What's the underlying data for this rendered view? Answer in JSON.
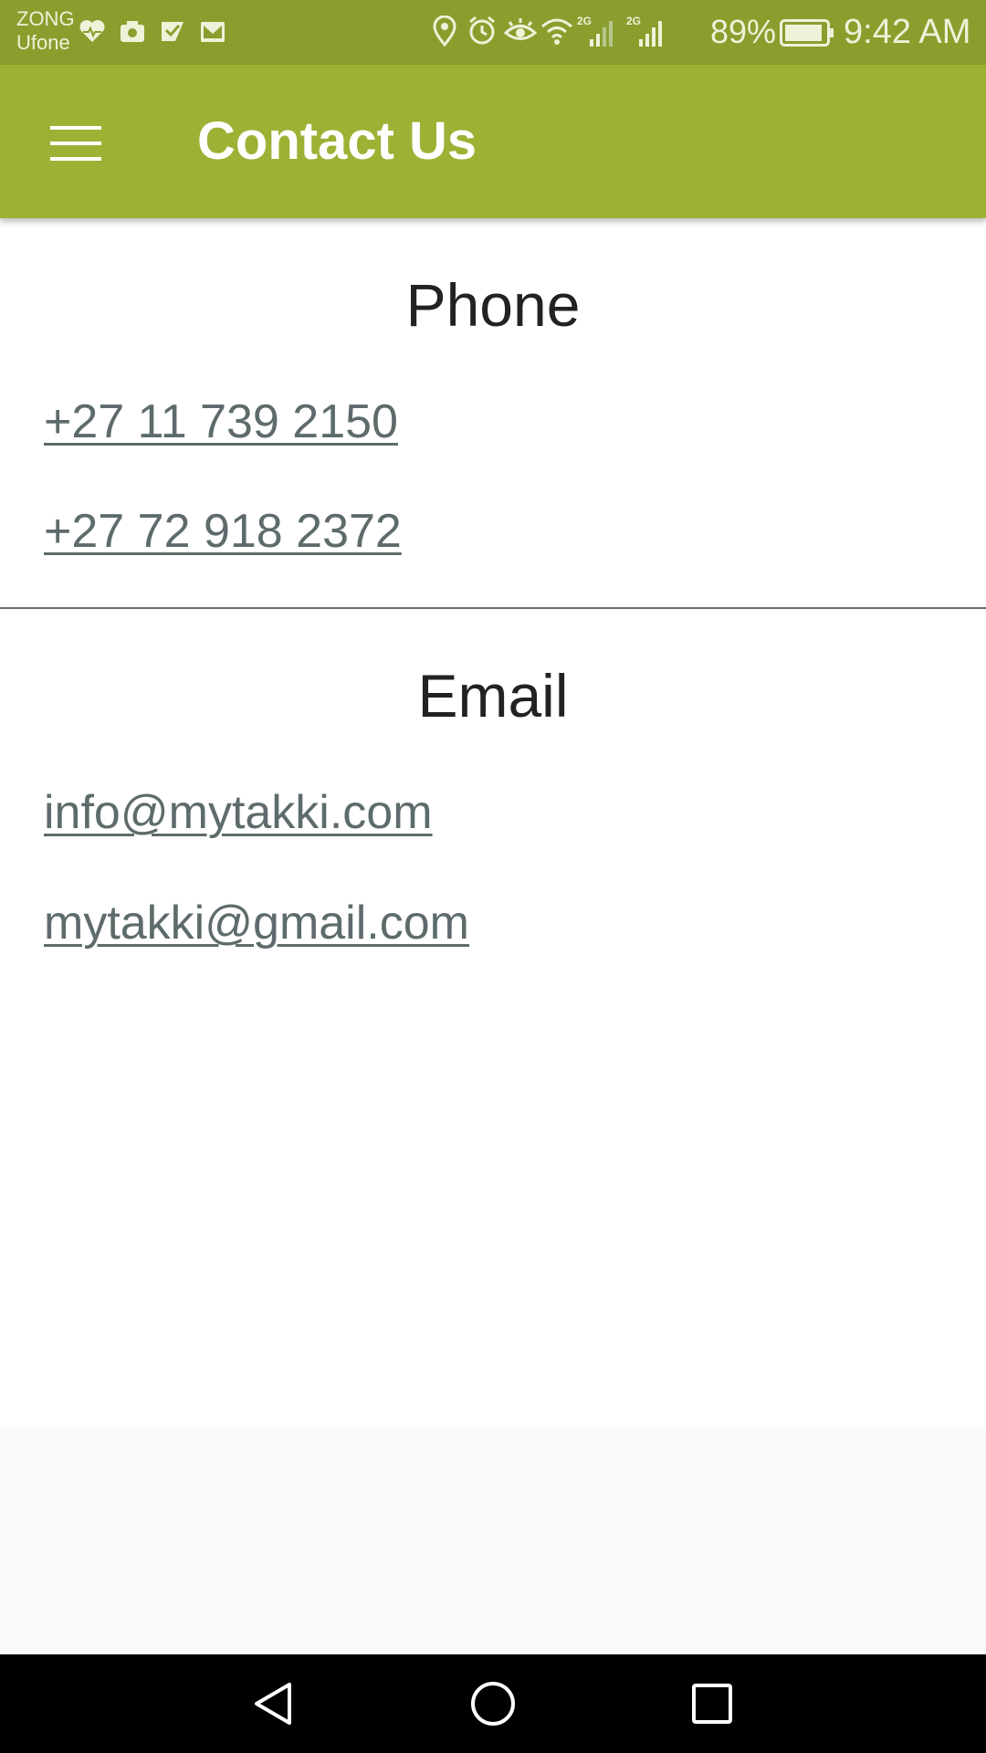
{
  "status_bar": {
    "carrier_1": "ZONG",
    "carrier_2": "Ufone",
    "battery_percent": "89%",
    "time": "9:42 AM",
    "network_1": "2G",
    "network_2": "2G"
  },
  "app_bar": {
    "title": "Contact Us",
    "color": "#9db135"
  },
  "phone_section": {
    "title": "Phone",
    "numbers": [
      "+27 11 739 2150",
      "+27 72 918 2372"
    ]
  },
  "email_section": {
    "title": "Email",
    "addresses": [
      "info@mytakki.com",
      "mytakki@gmail.com"
    ]
  },
  "nav_bar": {
    "icons": [
      "back-icon",
      "home-icon",
      "recents-icon"
    ]
  }
}
